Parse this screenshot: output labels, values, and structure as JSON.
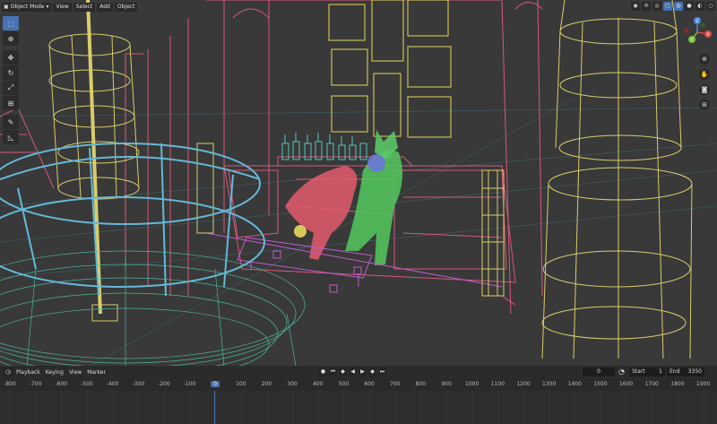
{
  "header": {
    "mode_icon": "object-mode-icon",
    "mode_label": "Object Mode",
    "menus": [
      "View",
      "Select",
      "Add",
      "Object"
    ]
  },
  "toolbar": {
    "tools": [
      "select-box-icon",
      "cursor-icon",
      "move-icon",
      "rotate-icon",
      "scale-icon",
      "transform-icon",
      "annotate-icon",
      "measure-icon"
    ]
  },
  "viewport_right": {
    "icons": [
      "visibility-icon",
      "gizmo-icon",
      "overlay-icon",
      "xray-icon",
      "wireframe-shading-icon",
      "solid-shading-icon",
      "material-shading-icon",
      "rendered-shading-icon"
    ],
    "gizmo_axes": {
      "x": "X",
      "y": "Y",
      "z": "Z"
    },
    "nav": [
      "zoom-icon",
      "pan-hand-icon",
      "camera-icon",
      "perspective-grid-icon"
    ]
  },
  "colors": {
    "pink": "#e0607a",
    "yellow": "#d9cd6a",
    "cyan": "#5fc6d6",
    "teal": "#4fc1a8",
    "green": "#50cc5a",
    "magenta": "#c25cd0",
    "accent": "#4772b3"
  },
  "timeline": {
    "editor_icon": "clock-icon",
    "menus": [
      "Playback",
      "Keying",
      "View",
      "Marker"
    ],
    "current_frame": "0",
    "start_label": "Start",
    "start_value": "1",
    "end_label": "End",
    "end_value": "3350",
    "ruler": [
      "-800",
      "-700",
      "-600",
      "-500",
      "-400",
      "-300",
      "-200",
      "-100",
      "0",
      "100",
      "200",
      "300",
      "400",
      "500",
      "600",
      "700",
      "800",
      "900",
      "1000",
      "1100",
      "1200",
      "1300",
      "1400",
      "1500",
      "1600",
      "1700",
      "1800",
      "1900"
    ]
  }
}
